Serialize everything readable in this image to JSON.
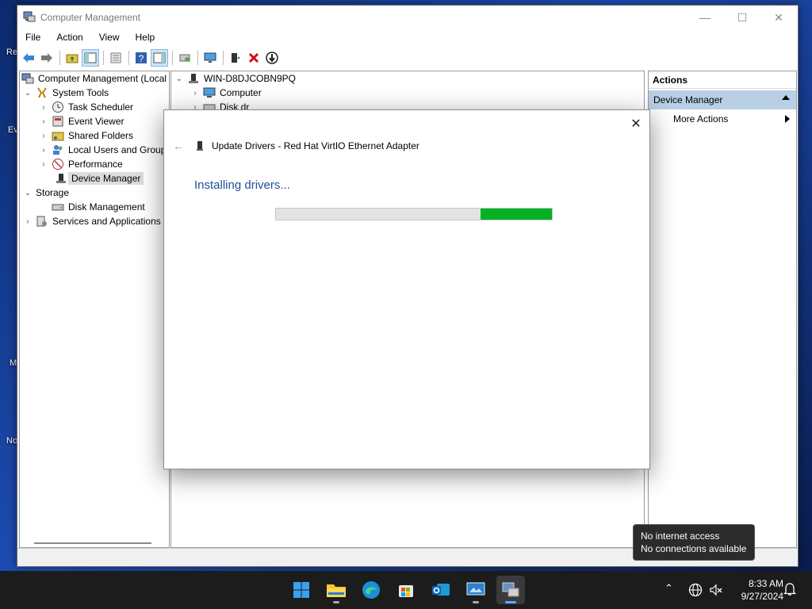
{
  "window": {
    "title": "Computer Management",
    "controls": {
      "minimize": "—",
      "maximize": "☐",
      "close": "✕"
    }
  },
  "menu": [
    "File",
    "Action",
    "View",
    "Help"
  ],
  "tree": {
    "root": "Computer Management (Local",
    "system_tools": "System Tools",
    "task_scheduler": "Task Scheduler",
    "event_viewer": "Event Viewer",
    "shared_folders": "Shared Folders",
    "local_users": "Local Users and Groups",
    "performance": "Performance",
    "device_manager": "Device Manager",
    "storage": "Storage",
    "disk_management": "Disk Management",
    "services": "Services and Applications"
  },
  "center": {
    "host": "WIN-D8DJCOBN9PQ",
    "computer": "Computer",
    "disk": "Disk dr"
  },
  "actions": {
    "header": "Actions",
    "section": "Device Manager",
    "more": "More Actions"
  },
  "dialog": {
    "title": "Update Drivers - Red Hat VirtIO Ethernet Adapter",
    "heading": "Installing drivers...",
    "progress_fill_fraction": 0.26
  },
  "tooltip": {
    "line1": "No internet access",
    "line2": "No connections available"
  },
  "clock": {
    "time": "8:33 AM",
    "date": "9/27/2024"
  },
  "desktop_labels": [
    "Re",
    "Ev",
    "M",
    "No"
  ]
}
